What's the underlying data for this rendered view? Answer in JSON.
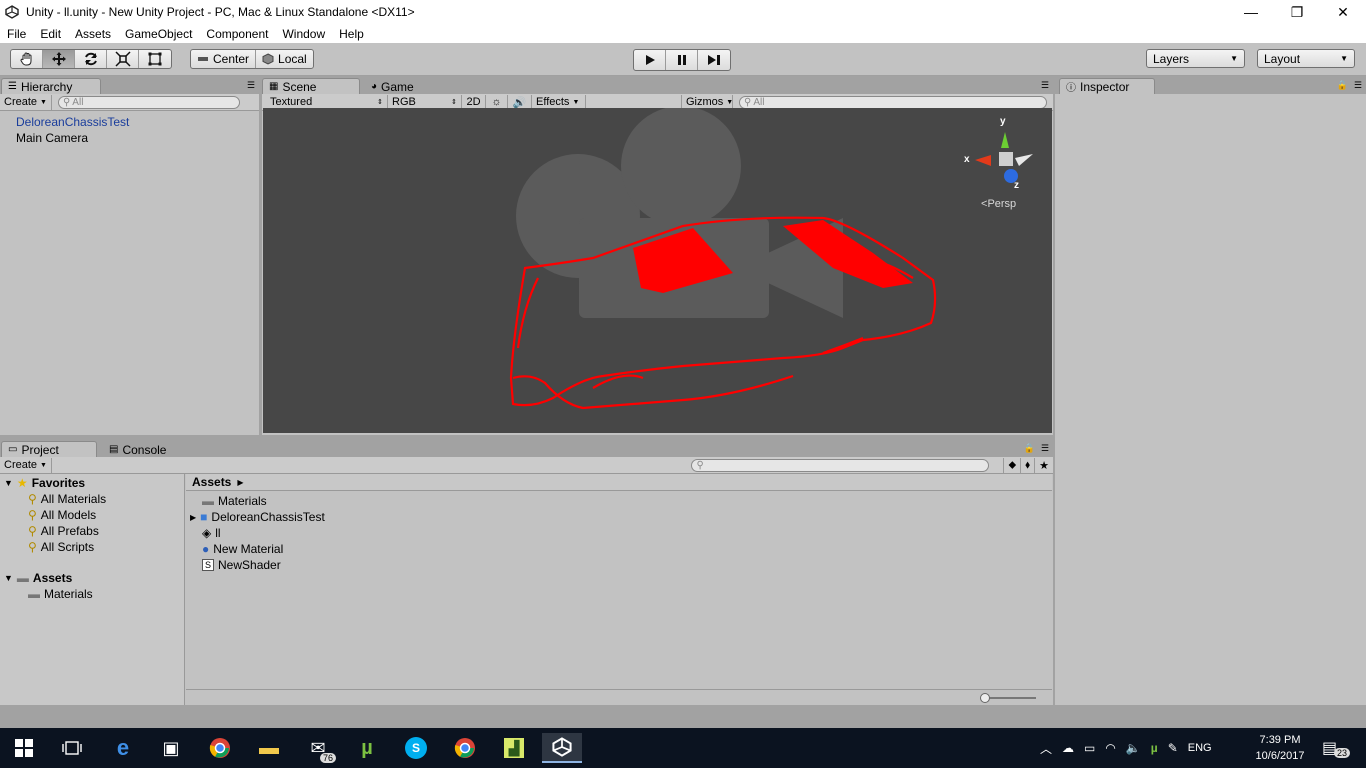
{
  "window": {
    "title": "Unity - ll.unity - New Unity Project - PC, Mac & Linux Standalone <DX11>",
    "minimize": "—",
    "maximize": "❐",
    "close": "✕"
  },
  "menu": [
    "File",
    "Edit",
    "Assets",
    "GameObject",
    "Component",
    "Window",
    "Help"
  ],
  "toolbar": {
    "pivot_center": "Center",
    "pivot_local": "Local",
    "layers": "Layers",
    "layout": "Layout"
  },
  "hierarchy": {
    "tab": "Hierarchy",
    "create": "Create",
    "search_placeholder": "All",
    "items": [
      "DeloreanChassisTest",
      "Main Camera"
    ]
  },
  "scene": {
    "tab_scene": "Scene",
    "tab_game": "Game",
    "shading": "Textured",
    "render_mode": "RGB",
    "mode_2d": "2D",
    "effects": "Effects",
    "gizmos": "Gizmos",
    "search_placeholder": "All",
    "gizmo_y": "y",
    "gizmo_x": "x",
    "gizmo_z": "z",
    "persp": "Persp",
    "wire_color": "#ff0000"
  },
  "inspector": {
    "tab": "Inspector"
  },
  "project": {
    "tab_project": "Project",
    "tab_console": "Console",
    "create": "Create",
    "favorites_label": "Favorites",
    "favorites": [
      "All Materials",
      "All Models",
      "All Prefabs",
      "All Scripts"
    ],
    "assets_label": "Assets",
    "assets_folders": [
      "Materials"
    ],
    "breadcrumb": "Assets",
    "files": [
      "Materials",
      "DeloreanChassisTest",
      "ll",
      "New Material",
      "NewShader"
    ]
  },
  "taskbar": {
    "mail_badge": "76",
    "lang": "ENG",
    "time": "7:39 PM",
    "date": "10/6/2017",
    "notif_count": "23"
  }
}
